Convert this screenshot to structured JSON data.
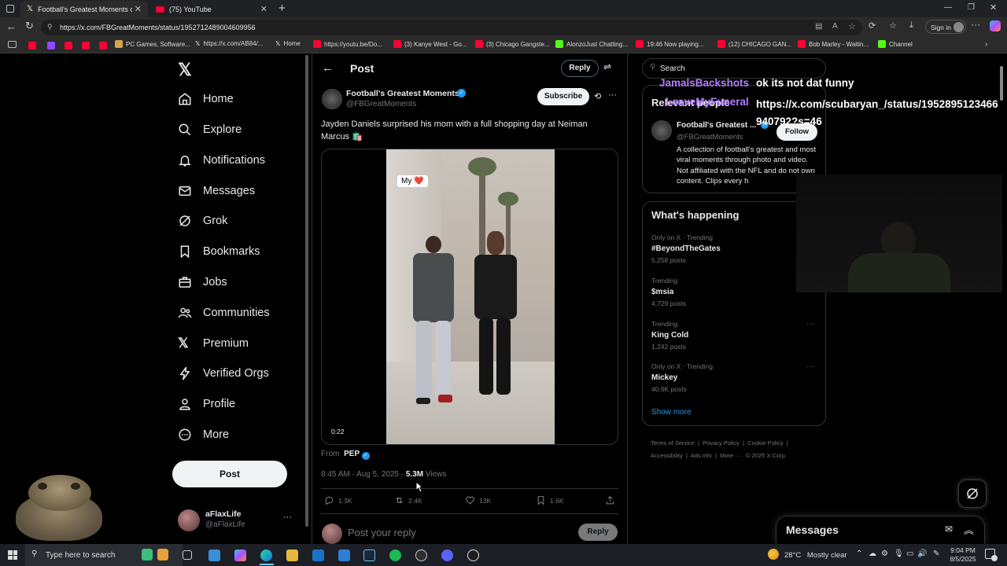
{
  "browser": {
    "tabs": [
      {
        "label": "Football's Greatest Moments on X"
      },
      {
        "label": "(75) YouTube"
      }
    ],
    "url": "https://x.com/FBGreatMoments/status/1952712489004609956",
    "sign_in": "Sign in",
    "bookmarks": [
      {
        "label": "PC Games, Software..."
      },
      {
        "label": "https://x.com/AB84/..."
      },
      {
        "label": "Home"
      },
      {
        "label": "https://youtu.be/Do..."
      },
      {
        "label": "(3) Kanye West - Go..."
      },
      {
        "label": "(3) Chicago Gangste..."
      },
      {
        "label": "AlonzoJust Chatting..."
      },
      {
        "label": "19:46 Now playing..."
      },
      {
        "label": "(12) CHICAGO GAN..."
      },
      {
        "label": "Bob Marley - Waitin..."
      },
      {
        "label": "Channel"
      }
    ]
  },
  "nav": {
    "items": [
      {
        "label": "Home",
        "icon": "home-icon"
      },
      {
        "label": "Explore",
        "icon": "search-icon"
      },
      {
        "label": "Notifications",
        "icon": "bell-icon"
      },
      {
        "label": "Messages",
        "icon": "mail-icon"
      },
      {
        "label": "Grok",
        "icon": "grok-icon"
      },
      {
        "label": "Bookmarks",
        "icon": "bookmark-icon"
      },
      {
        "label": "Jobs",
        "icon": "briefcase-icon"
      },
      {
        "label": "Communities",
        "icon": "people-icon"
      },
      {
        "label": "Premium",
        "icon": "x-logo-icon"
      },
      {
        "label": "Verified Orgs",
        "icon": "lightning-icon"
      },
      {
        "label": "Profile",
        "icon": "person-icon"
      },
      {
        "label": "More",
        "icon": "more-circle-icon"
      }
    ],
    "post_button": "Post",
    "account": {
      "name": "aFlaxLife",
      "handle": "@aFlaxLife"
    }
  },
  "post": {
    "header_title": "Post",
    "reply_button": "Reply",
    "author_name": "Football's Greatest Moments",
    "author_handle": "@FBGreatMoments",
    "subscribe": "Subscribe",
    "text": "Jayden Daniels surprised his mom with a full shopping day at Neiman Marcus 🛍️",
    "video_overlay": "My ❤️",
    "video_time": "0:22",
    "from_label": "From",
    "from_account": "PEP",
    "timestamp": "8:45 AM · Aug 5, 2025 · ",
    "views_count": "5.3M",
    "views_label": " Views",
    "stats": {
      "replies": "1.3K",
      "reposts": "2.4K",
      "likes": "13K",
      "bookmarks": "1.6K"
    },
    "reply_placeholder": "Post your reply",
    "reply_submit": "Reply"
  },
  "right": {
    "search_placeholder": "Search",
    "relevant_title": "Relevant people",
    "relevant_person": {
      "name": "Football's Greatest ...",
      "handle": "@FBGreatMoments",
      "follow": "Follow",
      "bio": "A collection of football's greatest and most viral moments through photo and video. Not affiliated with the NFL and do not own content. Clips every h"
    },
    "happening_title": "What's happening",
    "trends": [
      {
        "category": "Only on X · Trending",
        "name": "#BeyondTheGates",
        "count": "5,258 posts"
      },
      {
        "category": "Trending",
        "name": "$msia",
        "count": "4,729 posts"
      },
      {
        "category": "Trending",
        "name": "King Cold",
        "count": "1,242 posts"
      },
      {
        "category": "Only on X · Trending",
        "name": "Mickey",
        "count": "40.6K posts"
      }
    ],
    "show_more": "Show more",
    "footer_links": [
      "Terms of Service",
      "Privacy Policy",
      "Cookie Policy",
      "Accessibility",
      "Ads info",
      "More ···",
      "© 2025 X Corp."
    ],
    "messages_title": "Messages"
  },
  "stream_overlay": {
    "chat_user1": "JamalsBackshots",
    "chat_msg1": "ok its not dat funny",
    "chat_user2": "LeaveMyFuneral",
    "chat_msg2": "https://x.com/scubaryan_/status/1952895123466940792?s=46"
  },
  "taskbar": {
    "search_placeholder": "Type here to search",
    "weather_temp": "28°C",
    "weather_desc": "Mostly clear",
    "time": "9:04 PM",
    "date": "8/5/2025"
  },
  "colors": {
    "x_blue": "#1d9bf0",
    "chat_purple": "#b27cff",
    "chat_white": "#ffffff",
    "background": "#000000",
    "border": "#2f3336"
  }
}
